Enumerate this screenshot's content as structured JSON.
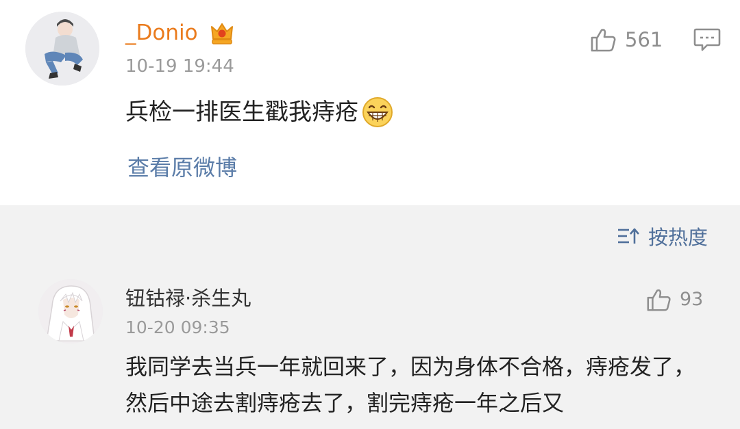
{
  "post": {
    "username": "_Donio",
    "badge": "crown-badge",
    "time": "10-19 19:44",
    "likes": "561",
    "text": "兵检一排医生戳我痔疮",
    "emoji": "grin-emoji",
    "view_original": "查看原微博"
  },
  "sort": {
    "label": "按热度",
    "icon": "sort-icon"
  },
  "comment": {
    "username": "钮钴禄·杀生丸",
    "time": "10-20 09:35",
    "likes": "93",
    "text": "我同学去当兵一年就回来了，因为身体不合格，痔疮发了，然后中途去割痔疮去了，割完痔疮一年之后又"
  },
  "colors": {
    "username_orange": "#ea7b1d",
    "link_blue": "#5a7ca8",
    "gray_text": "#9a9a9a",
    "background": "#f2f2f2"
  }
}
